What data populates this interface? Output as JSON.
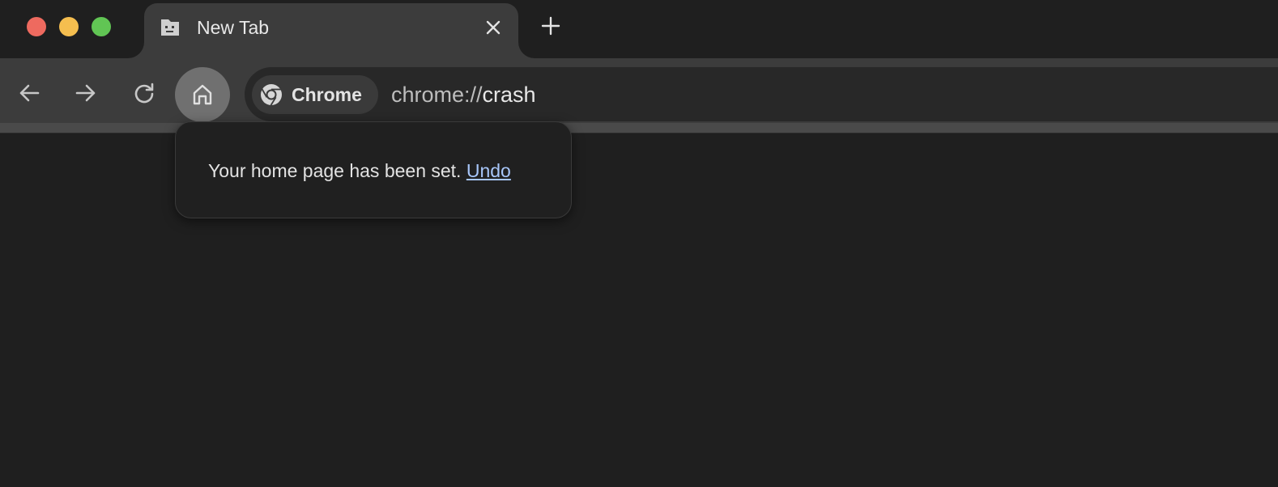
{
  "tab": {
    "title": "New Tab",
    "favicon": "sad-face-page-icon"
  },
  "toolbar": {
    "back_icon": "arrow-left-icon",
    "forward_icon": "arrow-right-icon",
    "reload_icon": "reload-icon",
    "home_icon": "home-icon"
  },
  "omnibox": {
    "chip_label": "Chrome",
    "url_scheme": "chrome://",
    "url_host": "crash"
  },
  "bubble": {
    "message": "Your home page has been set.",
    "undo_label": "Undo"
  },
  "colors": {
    "background": "#1f1f1f",
    "toolbar": "#3c3c3c",
    "link": "#a8c7fa",
    "close_light": "#ee6a5f",
    "minimize_light": "#f5be4f",
    "maximize_light": "#61c554"
  }
}
